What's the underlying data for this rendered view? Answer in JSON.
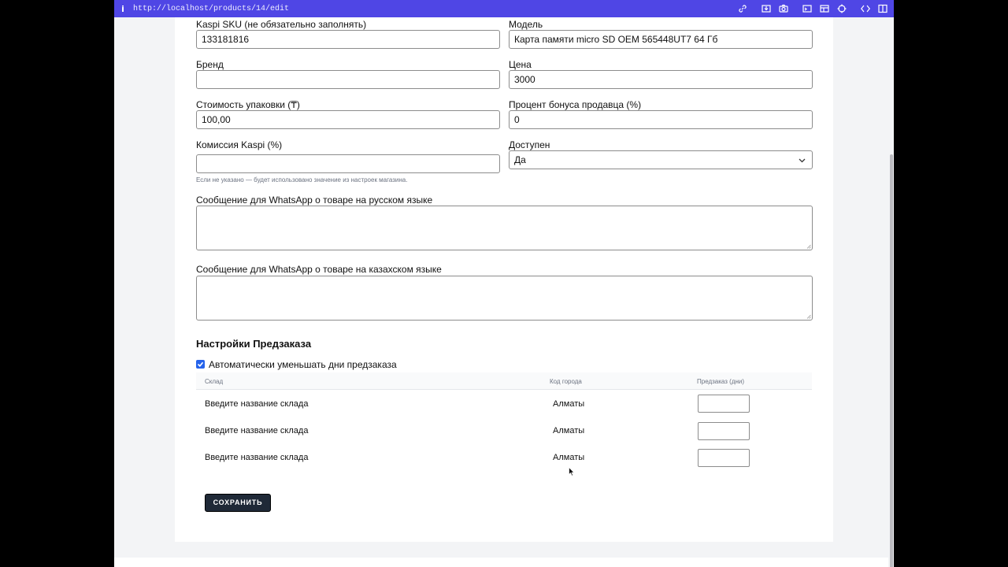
{
  "browser": {
    "info_icon": "i",
    "url": "http://localhost/products/14/edit",
    "tool_icons": [
      "link-icon",
      "download-icon",
      "camera-icon",
      "terminal-icon",
      "layout-icon",
      "target-icon",
      "expand-icon",
      "sidebar-icon"
    ]
  },
  "form": {
    "kaspi_sku": {
      "label": "Kaspi SKU (не обязательно заполнять)",
      "value": "133181816"
    },
    "model": {
      "label": "Модель",
      "value": "Карта памяти micro SD OEM 565448UT7 64 Гб"
    },
    "brand": {
      "label": "Бренд",
      "value": ""
    },
    "price": {
      "label": "Цена",
      "value": "3000"
    },
    "packaging_cost": {
      "label": "Стоимость упаковки (₸)",
      "value": "100,00"
    },
    "seller_bonus": {
      "label": "Процент бонуса продавца (%)",
      "value": "0"
    },
    "kaspi_commission": {
      "label": "Комиссия Kaspi (%)",
      "value": "",
      "hint": "Если не указано — будет использовано значение из настроек магазина."
    },
    "available": {
      "label": "Доступен",
      "value": "Да"
    },
    "whatsapp_ru": {
      "label": "Сообщение для WhatsApp о товаре на русском языке",
      "value": ""
    },
    "whatsapp_kz": {
      "label": "Сообщение для WhatsApp о товаре на казахском языке",
      "value": ""
    }
  },
  "preorder": {
    "title": "Настройки Предзаказа",
    "auto_decrease_label": "Автоматически уменьшать дни предзаказа",
    "auto_decrease_checked": true,
    "columns": [
      "Склад",
      "Код города",
      "Предзаказ (дни)"
    ],
    "rows": [
      {
        "warehouse": "Введите название склада",
        "city": "Алматы",
        "days": ""
      },
      {
        "warehouse": "Введите название склада",
        "city": "Алматы",
        "days": ""
      },
      {
        "warehouse": "Введите название склада",
        "city": "Алматы",
        "days": ""
      }
    ]
  },
  "save_label": "СОХРАНИТЬ",
  "colors": {
    "browser_bar": "#4f46e5",
    "checkbox": "#2563eb",
    "save_button": "#1f2937"
  }
}
